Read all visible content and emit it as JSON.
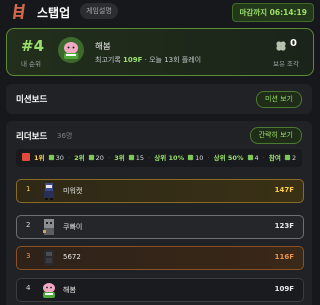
{
  "header": {
    "title": "스탭업",
    "guide_label": "게임설명",
    "deadline": "마감까지 06:14:19",
    "logo_icon": "ladder-icon",
    "accent": "#9be06c"
  },
  "my_card": {
    "rank": "#4",
    "rank_label": "내 순위",
    "name": "해봄",
    "record_prefix": "최고기록",
    "record_value": "109F",
    "record_suffix": "· 오늘 13회 플레이",
    "clover_count": "0",
    "clover_label": "보유 조각",
    "clover_icon": "clover-icon"
  },
  "mission": {
    "title": "미션보드",
    "button": "미션 보기"
  },
  "leaderboard": {
    "title": "리더보드",
    "count": "36명",
    "button": "간략히 보기",
    "rewards": [
      {
        "label": "1위",
        "amount": "30"
      },
      {
        "label": "2위",
        "amount": "20"
      },
      {
        "label": "3위",
        "amount": "15"
      },
      {
        "label": "상위 10%",
        "amount": "10"
      },
      {
        "label": "상위 50%",
        "amount": "4"
      },
      {
        "label": "참여",
        "amount": "2"
      }
    ],
    "rows": [
      {
        "rank": "1",
        "name": "미워캣",
        "floor": "147F"
      },
      {
        "rank": "2",
        "name": "쿠빠이",
        "floor": "123F"
      },
      {
        "rank": "3",
        "name": "5672",
        "floor": "116F"
      },
      {
        "rank": "4",
        "name": "해봄",
        "floor": "109F"
      }
    ]
  }
}
